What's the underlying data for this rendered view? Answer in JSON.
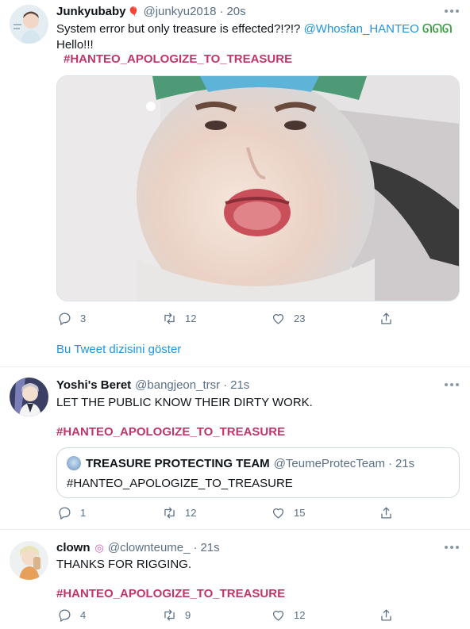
{
  "colors": {
    "text": "#0f1419",
    "muted": "#5b7083",
    "link": "#1b95e0",
    "hashtag": "#c2356b",
    "divider": "#e6ecf0"
  },
  "tweets": [
    {
      "name": "Junkyubaby",
      "name_emoji": "🎈",
      "handle": "@junkyu2018",
      "separator": "·",
      "time": "20s",
      "text": "System error but only treasure is effected?!?!?",
      "mention": "@Whosfan_HANTEO",
      "emoji_after": "ᘏᘏᘏ",
      "text_line2": "Hello!!!",
      "hashtag": "#HANTEO_APOLOGIZE_TO_TREASURE",
      "media_icon": "photo-close-up-face",
      "replies": "3",
      "retweets": "12",
      "likes": "23",
      "show_thread": "Bu Tweet dizisini göster"
    },
    {
      "name": "Yoshi's Beret",
      "handle": "@bangjeon_trsr",
      "separator": "·",
      "time": "21s",
      "text": "LET THE PUBLIC KNOW THEIR DIRTY WORK.",
      "hashtag": "#HANTEO_APOLOGIZE_TO_TREASURE",
      "quote": {
        "name": "TREASURE PROTECTING TEAM",
        "handle": "@TeumeProtecTeam",
        "separator": "·",
        "time": "21s",
        "text": "#HANTEO_APOLOGIZE_TO_TREASURE"
      },
      "replies": "1",
      "retweets": "12",
      "likes": "15"
    },
    {
      "name": "clown",
      "name_emoji": "◎",
      "handle": "@clownteume_",
      "separator": "·",
      "time": "21s",
      "text": "THANKS FOR RIGGING.",
      "hashtag": "#HANTEO_APOLOGIZE_TO_TREASURE",
      "replies": "4",
      "retweets": "9",
      "likes": "12"
    }
  ]
}
